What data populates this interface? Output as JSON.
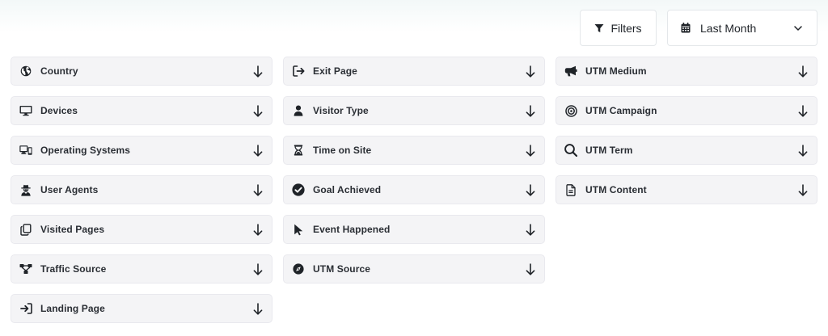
{
  "toolbar": {
    "filters_label": "Filters",
    "date_range_label": "Last Month"
  },
  "columns": [
    {
      "items": [
        {
          "label": "Country",
          "icon": "globe-icon"
        },
        {
          "label": "Devices",
          "icon": "monitor-icon"
        },
        {
          "label": "Operating Systems",
          "icon": "desktop-mobile-icon"
        },
        {
          "label": "User Agents",
          "icon": "user-secret-icon"
        },
        {
          "label": "Visited Pages",
          "icon": "copy-pages-icon"
        },
        {
          "label": "Traffic Source",
          "icon": "sitemap-icon"
        },
        {
          "label": "Landing Page",
          "icon": "sign-in-icon"
        }
      ]
    },
    {
      "items": [
        {
          "label": "Exit Page",
          "icon": "sign-out-icon"
        },
        {
          "label": "Visitor Type",
          "icon": "user-icon"
        },
        {
          "label": "Time on Site",
          "icon": "hourglass-icon"
        },
        {
          "label": "Goal Achieved",
          "icon": "check-circle-icon"
        },
        {
          "label": "Event Happened",
          "icon": "cursor-icon"
        },
        {
          "label": "UTM Source",
          "icon": "compass-icon"
        }
      ]
    },
    {
      "items": [
        {
          "label": "UTM Medium",
          "icon": "megaphone-icon"
        },
        {
          "label": "UTM Campaign",
          "icon": "target-icon"
        },
        {
          "label": "UTM Term",
          "icon": "search-icon"
        },
        {
          "label": "UTM Content",
          "icon": "file-text-icon"
        }
      ]
    }
  ]
}
